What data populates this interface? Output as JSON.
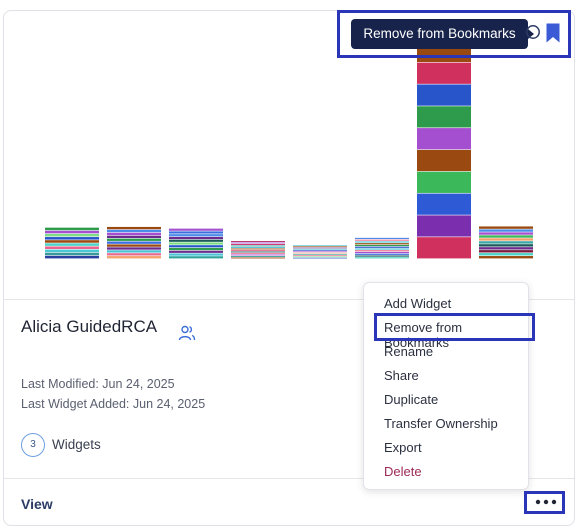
{
  "card": {
    "title": "Alicia GuidedRCA",
    "last_modified": "Last Modified: Jun 24, 2025",
    "last_widget_added": "Last Widget Added: Jun 24, 2025",
    "widget_count": "3",
    "widgets_label": "Widgets",
    "view_label": "View"
  },
  "tooltip": {
    "text": "Remove from Bookmarks"
  },
  "menu": {
    "items": [
      "Add Widget",
      "Remove from Bookmarks",
      "Rename",
      "Share",
      "Duplicate",
      "Transfer Ownership",
      "Export",
      "Delete"
    ]
  },
  "icons": {
    "share": "users-icon",
    "circle": "circle-icon",
    "bookmark": "bookmark-icon",
    "more": "more-horizontal-icon"
  },
  "colors": {
    "accent_outline": "#2b35b8",
    "tooltip_bg": "#17234a",
    "delete": "#9c2a55",
    "bookmark": "#3b5bd6"
  },
  "thumbnail": {
    "stacks": [
      [
        "#2b3fa0",
        "#3a9a9a",
        "#4ac8d6",
        "#e9658e",
        "#4dd3c8",
        "#9b4a12",
        "#2855c9",
        "#7fdc86",
        "#a44ed0",
        "#2e9a4b"
      ],
      [
        "#f2a26b",
        "#e96b8d",
        "#4ac3d6",
        "#6b2b8f",
        "#9a4a10",
        "#3b6fe0",
        "#2e9a4b",
        "#6b2b8f",
        "#a44ed0",
        "#4a8ce8",
        "#9a4a10"
      ],
      [
        "#2fa39a",
        "#4ac3d6",
        "#6b2b8f",
        "#2e9a4b",
        "#2855c9",
        "#7fdc86",
        "#1e5a5a",
        "#6b2b8f",
        "#4a8ce8",
        "#3b6fe0",
        "#a44ed0"
      ],
      [
        "#9a4a10",
        "#2fa39a",
        "#a44ed0",
        "#f27b9c",
        "#1e5a5a",
        "#e96b8d",
        "#9a4a10",
        "#4ac3d6",
        "#3a9a9a",
        "#c9295e",
        "#a44ed0",
        "#b0285c"
      ],
      [
        "#2855c9",
        "#7fdc86",
        "#e96b8d",
        "#2fa39a",
        "#f2a26b",
        "#a44ed0",
        "#2855c9",
        "#4ac3d6",
        "#6b2b8f",
        "#9a4a10",
        "#4ac8d6"
      ],
      [
        "#4dd3c8",
        "#1e5a5a",
        "#3b6fe0",
        "#a44ed0",
        "#e96b8d",
        "#4ac3d6",
        "#2855c9",
        "#2e9a4b",
        "#9a4a10",
        "#4ac8d6",
        "#f27b9c",
        "#4a8ce8"
      ],
      [
        "#d0305e",
        "#7b2fae",
        "#2e5ad6",
        "#3bb85a",
        "#9a4a10",
        "#a44ed0",
        "#2e9a4b",
        "#2855c9",
        "#d0305e",
        "#9a4a10",
        "#6b2b8f"
      ],
      [
        "#9a4a10",
        "#4dd3c8",
        "#7b1a3a",
        "#6b2b8f",
        "#1e5a5a",
        "#3aa8a8",
        "#f2a26b",
        "#3bb85a",
        "#a44ed0",
        "#4a8ce8",
        "#9a4a10"
      ]
    ],
    "totals": [
      129,
      132,
      125,
      74,
      57,
      87,
      1000,
      134
    ]
  }
}
